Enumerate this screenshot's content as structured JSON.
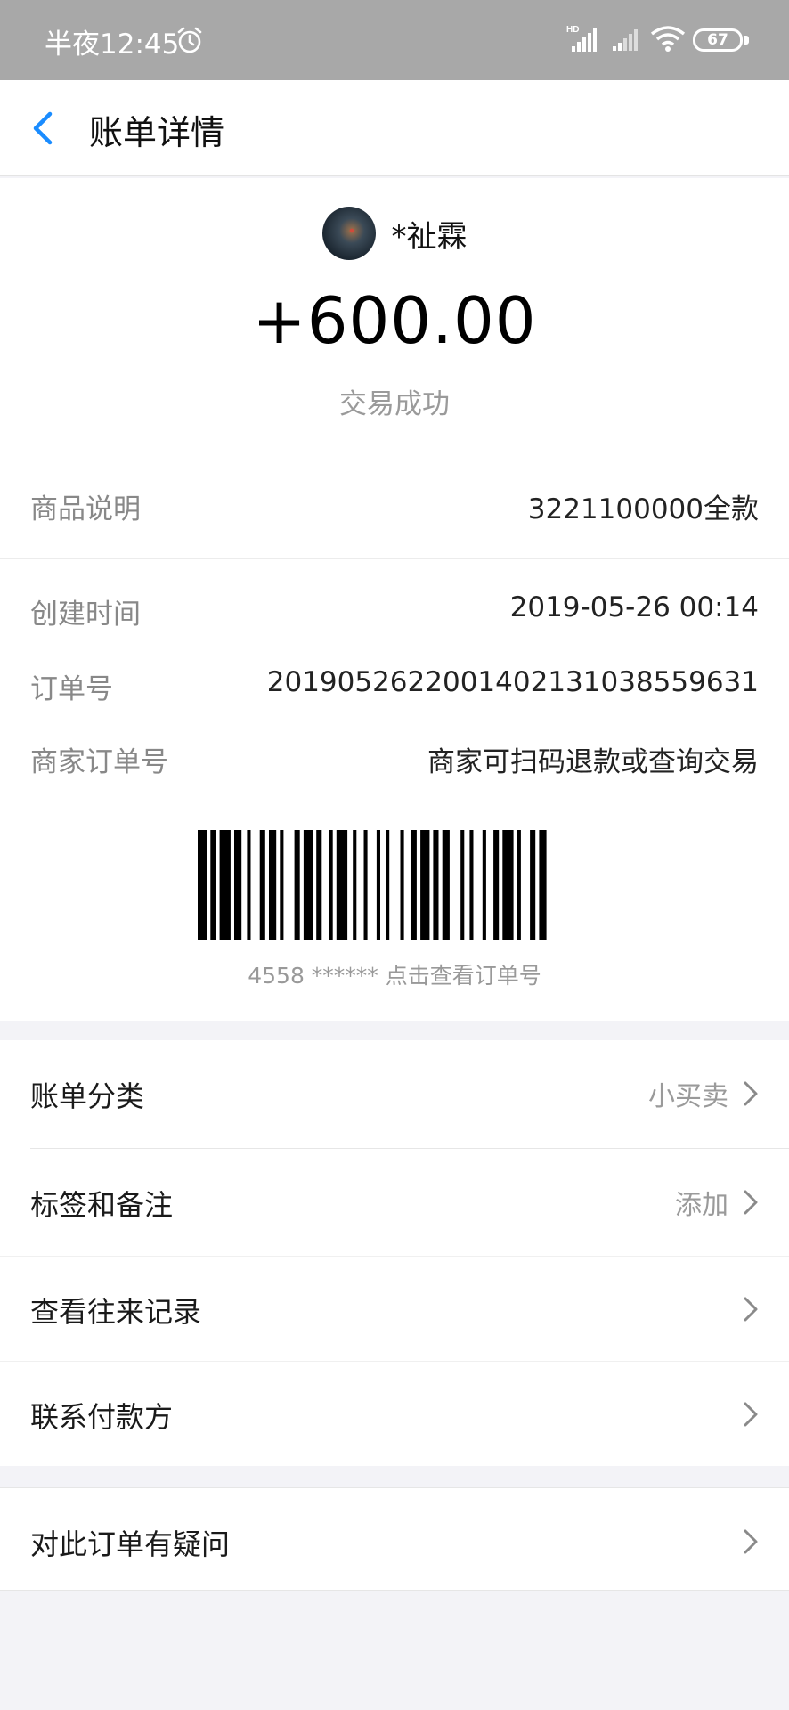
{
  "status_bar": {
    "time": "半夜12:45",
    "battery": "67",
    "icons": [
      "alarm-icon",
      "hd-signal-icon",
      "signal-icon",
      "wifi-icon",
      "battery-icon"
    ]
  },
  "nav": {
    "title": "账单详情",
    "back_icon": "chevron-left-icon",
    "accent_color": "#1a8cff"
  },
  "transaction": {
    "payer_name": "*祉霖",
    "amount": "+600.00",
    "status": "交易成功"
  },
  "details": [
    {
      "label": "商品说明",
      "value": "3221100000全款"
    },
    {
      "label": "创建时间",
      "value": "2019-05-26 00:14"
    },
    {
      "label": "订单号",
      "value": "20190526220014021310385596​31"
    },
    {
      "label": "商家订单号",
      "value": "商家可扫码退款或查询交易"
    }
  ],
  "barcode_caption": "4558 ****** 点击查看订单号",
  "menu": [
    {
      "label": "账单分类",
      "value": "小买卖"
    },
    {
      "label": "标签和备注",
      "value": "添加"
    },
    {
      "label": "查看往来记录",
      "value": ""
    },
    {
      "label": "联系付款方",
      "value": ""
    }
  ],
  "menu_extra": {
    "label": "对此订单有疑问"
  }
}
